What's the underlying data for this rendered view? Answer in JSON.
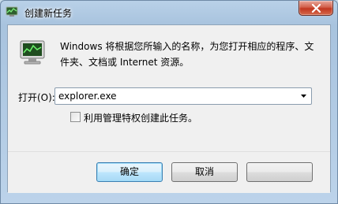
{
  "window": {
    "title": "创建新任务",
    "icons": {
      "title": "task-manager-icon",
      "close": "close-icon",
      "app": "task-manager-icon"
    }
  },
  "content": {
    "description": "Windows 将根据您所输入的名称，为您打开相应的程序、文件夹、文档或 Internet 资源。",
    "open_label": "打开(O):",
    "open_value": "explorer.exe",
    "admin_checkbox_label": "利用管理特权创建此任务。",
    "admin_checked": false
  },
  "buttons": {
    "ok": "确定",
    "cancel": "取消",
    "browse": ""
  },
  "colors": {
    "accent": "#3c7fb1",
    "close_red": "#c2371f",
    "frame": "#b9d1e8"
  }
}
